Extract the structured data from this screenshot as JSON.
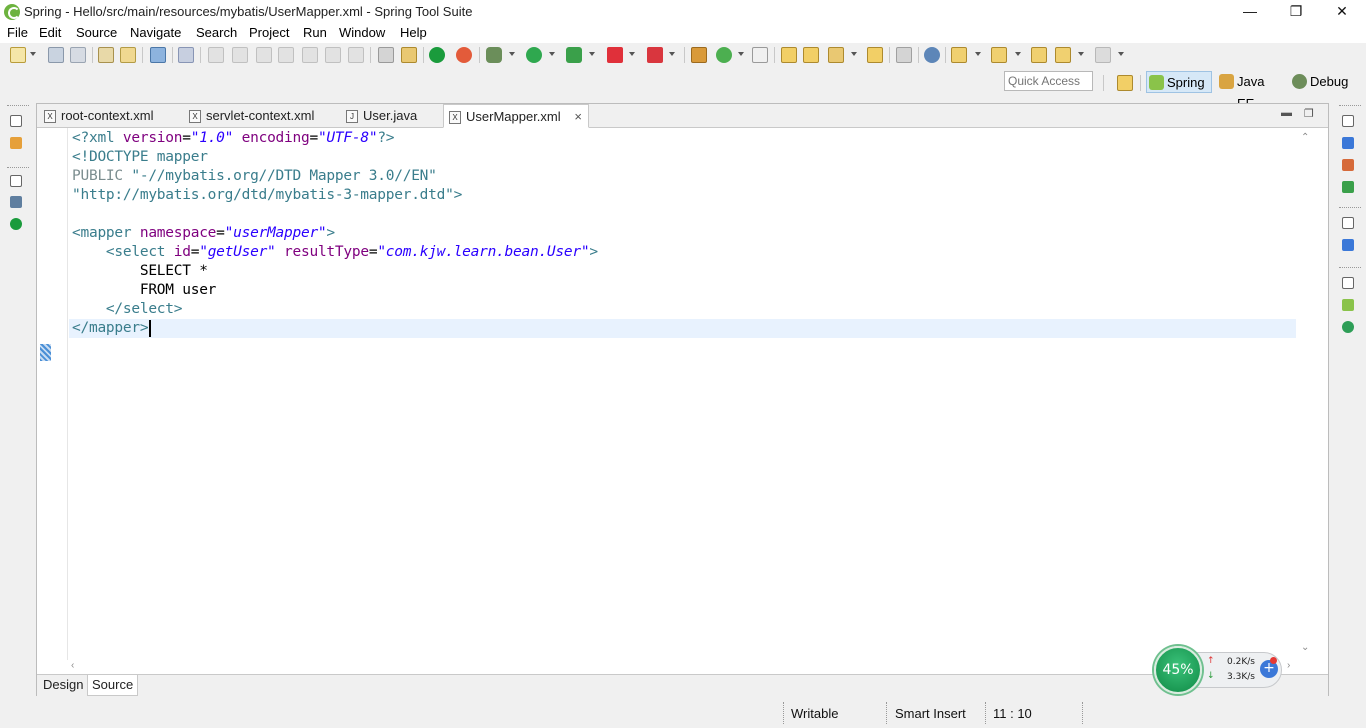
{
  "window": {
    "title": "Spring - Hello/src/main/resources/mybatis/UserMapper.xml - Spring Tool Suite",
    "minimize_icon": "minimize-icon",
    "maximize_icon": "restore-icon",
    "close_icon": "close-icon"
  },
  "menu": [
    {
      "label": "File"
    },
    {
      "label": "Edit"
    },
    {
      "label": "Source"
    },
    {
      "label": "Navigate"
    },
    {
      "label": "Search"
    },
    {
      "label": "Project"
    },
    {
      "label": "Run"
    },
    {
      "label": "Window"
    },
    {
      "label": "Help"
    }
  ],
  "quick_access": {
    "placeholder": "Quick Access"
  },
  "perspectives": [
    {
      "label": "Spring",
      "icon": "spring-leaf-icon",
      "active": true
    },
    {
      "label": "Java EE",
      "icon": "java-ee-icon",
      "active": false
    },
    {
      "label": "Debug",
      "icon": "debug-bug-icon",
      "active": false
    }
  ],
  "tabs": [
    {
      "label": "root-context.xml",
      "icon": "xml-file-icon"
    },
    {
      "label": "servlet-context.xml",
      "icon": "xml-file-icon"
    },
    {
      "label": "User.java",
      "icon": "java-file-icon"
    },
    {
      "label": "UserMapper.xml",
      "icon": "xml-file-icon",
      "active": true,
      "close": "×"
    }
  ],
  "code": {
    "l1": {
      "a": "<?xml ",
      "b": "version",
      "c": "=",
      "d": "\"1.0\"",
      "e": " ",
      "f": "encoding",
      "g": "=",
      "h": "\"UTF-8\"",
      "i": "?>"
    },
    "l2": "<!DOCTYPE mapper",
    "l3": {
      "a": "PUBLIC ",
      "b": "\"-//mybatis.org//DTD Mapper 3.0//EN\""
    },
    "l4": "\"http://mybatis.org/dtd/mybatis-3-mapper.dtd\">",
    "l6": {
      "a": "<mapper ",
      "b": "namespace",
      "c": "=",
      "d": "\"userMapper\"",
      "e": ">"
    },
    "l7": {
      "indent": "    ",
      "a": "<select ",
      "b": "id",
      "c": "=",
      "d": "\"getUser\"",
      "e": " ",
      "f": "resultType",
      "g": "=",
      "h": "\"com.kjw.learn.bean.User\"",
      "i": ">"
    },
    "l8": "        SELECT *",
    "l9": "        FROM user",
    "l10": {
      "indent": "    ",
      "a": "</select>"
    },
    "l11": "</mapper>"
  },
  "editor_bottom_tabs": [
    {
      "label": "Design"
    },
    {
      "label": "Source",
      "active": true
    }
  ],
  "status": {
    "mode": "Writable",
    "insert": "Smart Insert",
    "position": "11 : 10"
  },
  "network": {
    "percent": "45%",
    "upload": "0.2K/s",
    "download": "3.3K/s",
    "plus": "+"
  },
  "colors": {
    "tag": "#3a7d8c",
    "attribute": "#7f007f",
    "value": "#2a00ff",
    "current_line": "#e8f2fe"
  }
}
